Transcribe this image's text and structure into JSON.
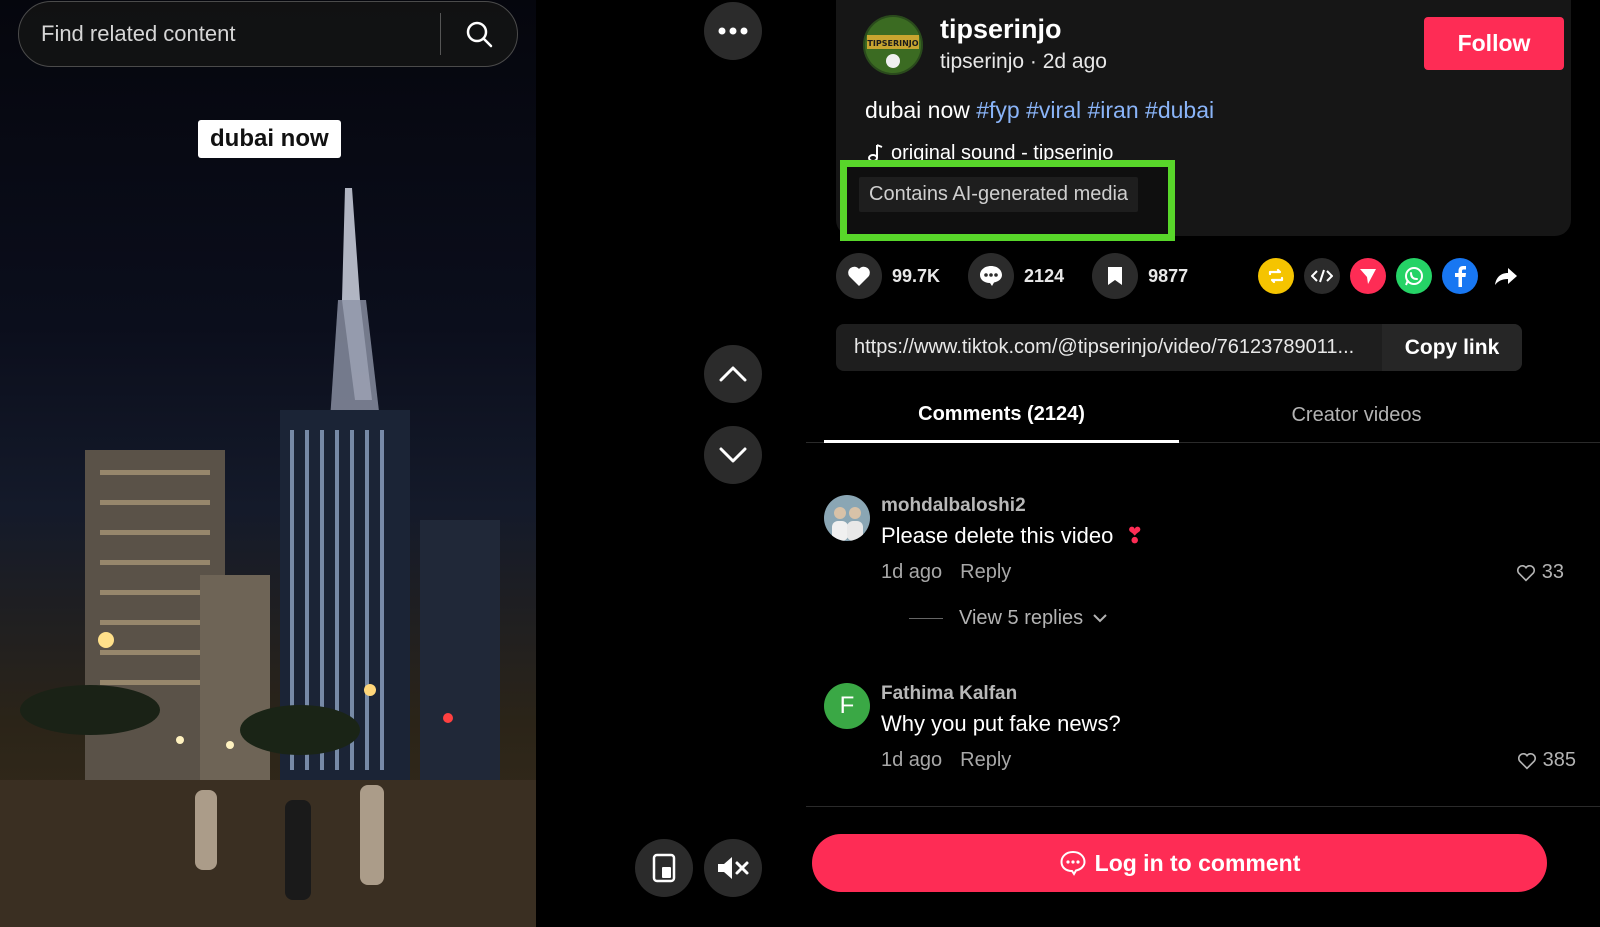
{
  "search": {
    "placeholder": "Find related content"
  },
  "video": {
    "overlay_caption": "dubai now"
  },
  "author": {
    "display_name": "tipserinjo",
    "meta": "tipserinjo · 2d ago",
    "follow_label": "Follow",
    "avatar_text": "TIPSERINJO"
  },
  "description": {
    "text": "dubai now",
    "hashtags": [
      "#fyp",
      "#viral",
      "#iran",
      "#dubai"
    ],
    "music": "original sound - tipserinjo",
    "ai_label": "Contains AI-generated media"
  },
  "stats": {
    "likes": "99.7K",
    "comments": "2124",
    "saves": "9877"
  },
  "share": {
    "icons": [
      "repost-icon",
      "embed-icon",
      "send-icon",
      "whatsapp-icon",
      "facebook-icon",
      "share-arrow-icon"
    ],
    "colors": {
      "repost": "#f5c400",
      "embed": "#2b2b2b",
      "send": "#fe2c55",
      "whatsapp": "#25d366",
      "facebook": "#1877f2"
    }
  },
  "link": {
    "url": "https://www.tiktok.com/@tipserinjo/video/76123789011...",
    "copy_label": "Copy link"
  },
  "tabs": {
    "comments": "Comments (2124)",
    "creator": "Creator videos"
  },
  "comments": [
    {
      "user": "mohdalbaloshi2",
      "text": "Please delete this video",
      "emoji": "❣",
      "time": "1d ago",
      "reply": "Reply",
      "likes": "33",
      "view_replies": "View 5 replies"
    },
    {
      "user": "Fathima Kalfan",
      "initial": "F",
      "text": "Why you put fake news?",
      "time": "1d ago",
      "reply": "Reply",
      "likes": "385"
    }
  ],
  "footer": {
    "login_label": "Log in to comment"
  },
  "colors": {
    "accent": "#fe2c55",
    "highlight": "#58d62a",
    "hashtag": "#8ab4f8"
  }
}
